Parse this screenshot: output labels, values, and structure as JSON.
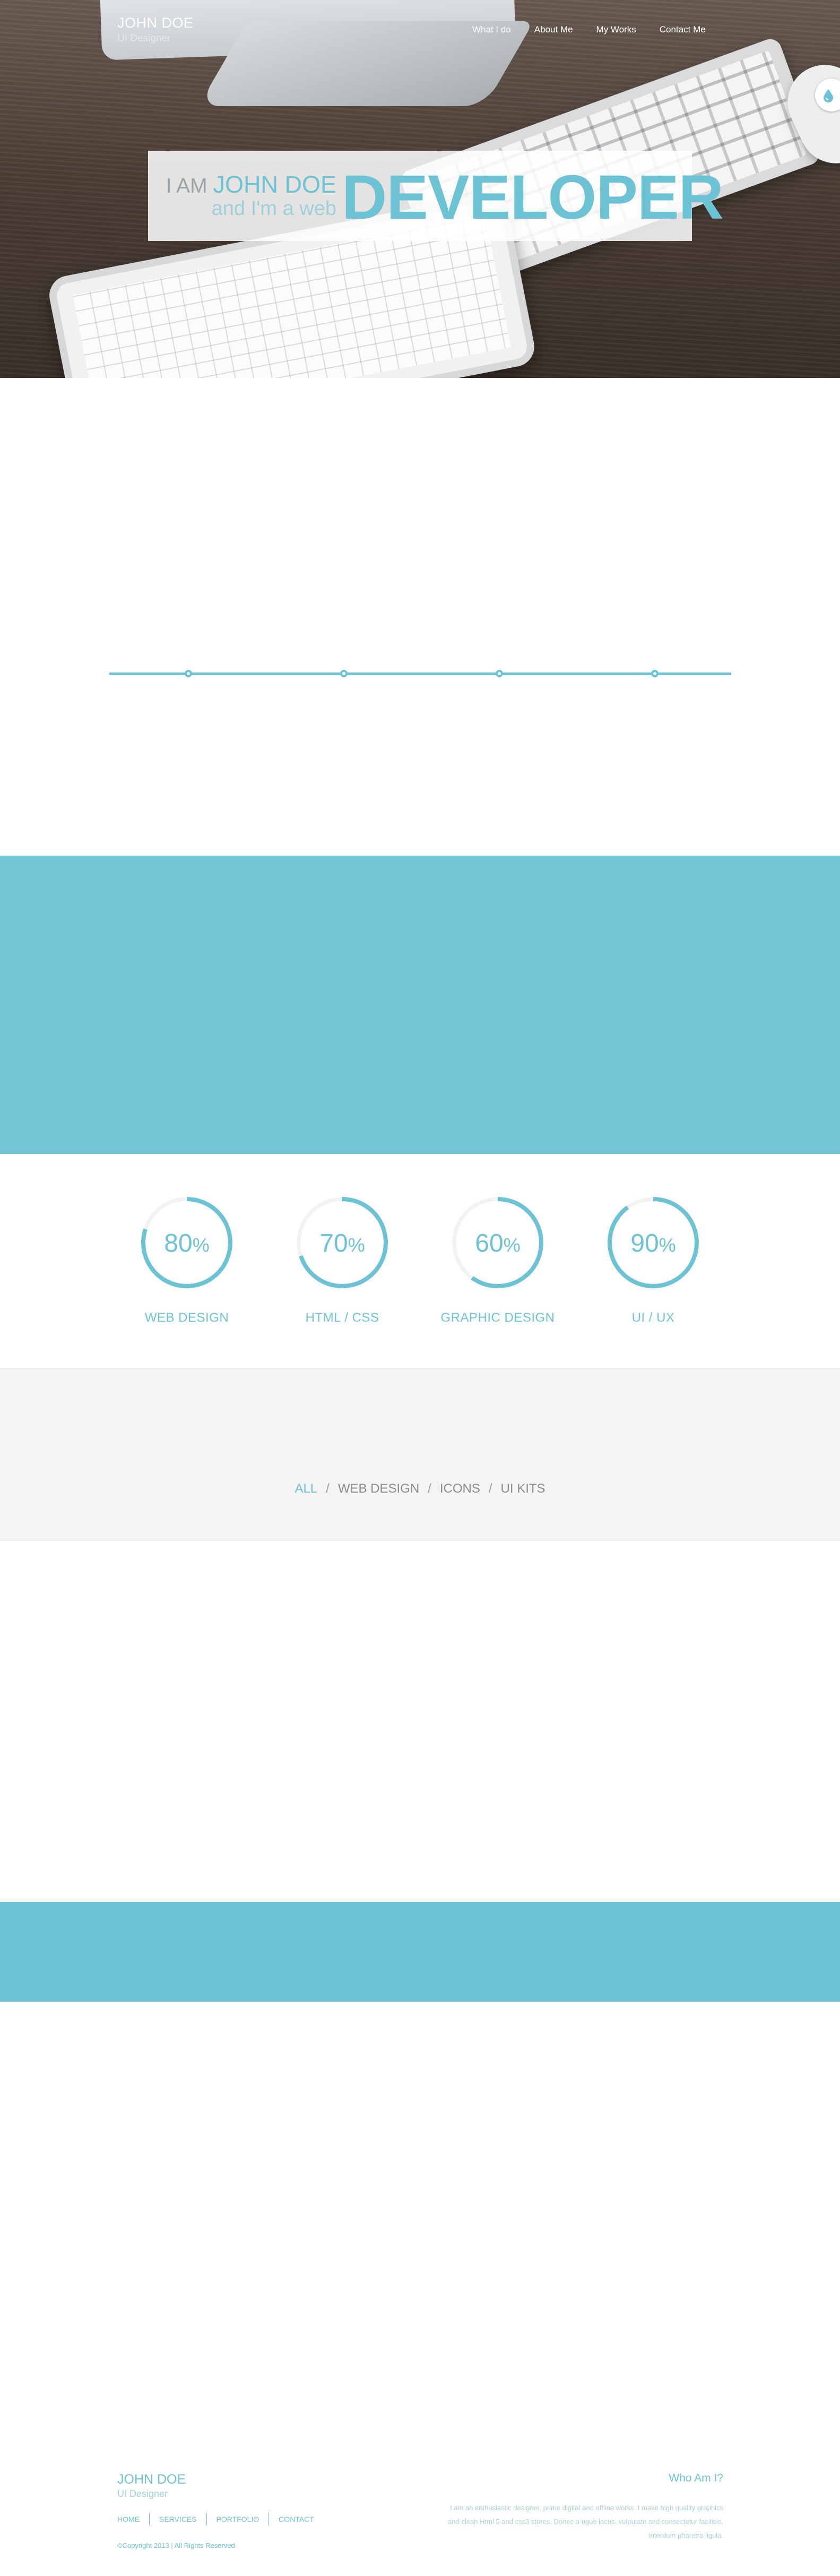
{
  "header": {
    "brand_name": "JOHN DOE",
    "brand_tagline": "UI Designer",
    "nav": [
      {
        "label": "What I do"
      },
      {
        "label": "About Me"
      },
      {
        "label": "My Works"
      },
      {
        "label": "Contact Me"
      }
    ],
    "drop_icon": "water-drop-icon"
  },
  "hero": {
    "i_am": "I AM",
    "name": "JOHN DOE",
    "subline": "and I'm a web",
    "big_word": "DEVELOPER"
  },
  "timeline": {
    "dot_count": 4
  },
  "skills": [
    {
      "percent": 80,
      "percent_text": "80",
      "label": "WEB DESIGN"
    },
    {
      "percent": 70,
      "percent_text": "70",
      "label": "HTML / CSS"
    },
    {
      "percent": 60,
      "percent_text": "60",
      "label": "GRAPHIC DESIGN"
    },
    {
      "percent": 90,
      "percent_text": "90",
      "label": "UI / UX"
    }
  ],
  "percent_symbol": "%",
  "portfolio_filter": {
    "items": [
      "ALL",
      "WEB DESIGN",
      "ICONS",
      "UI KITS"
    ],
    "active": "ALL",
    "separator": "/"
  },
  "footer": {
    "name": "JOHN DOE",
    "role": "UI Designer",
    "nav": [
      "HOME",
      "SERVICES",
      "PORTFOLIO",
      "CONTACT"
    ],
    "copyright": "©Copyright 2013 | All Rights Reserved",
    "about_title": "Who Am I?",
    "about_text": "I am an enthusiastic designer, prime digital and offline works. I make high quality graphics and clean Html 5 and css3 stores. Donec a ugue lacus, vulputate sed consectetur facilisis, interdum pharetra ligula."
  },
  "colors": {
    "accent": "#6dc3d3",
    "teal_band": "#75c6d5",
    "filter_bg": "#f4f4f4"
  }
}
